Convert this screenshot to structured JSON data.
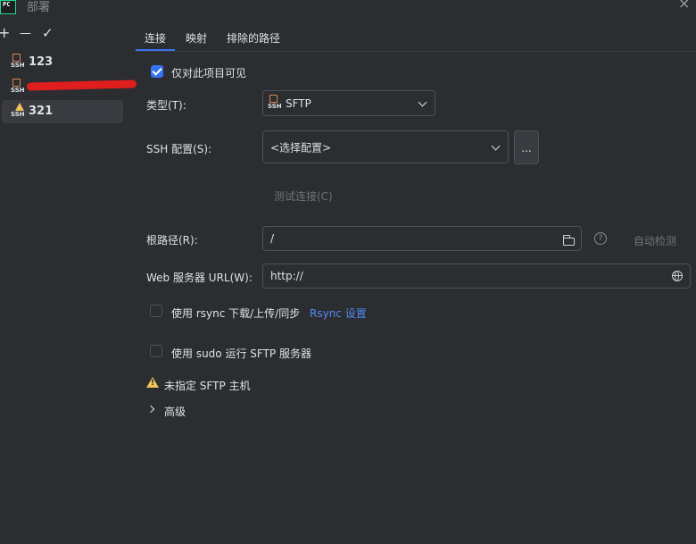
{
  "window": {
    "title": "部署",
    "app_icon_label": "PC"
  },
  "toolbar": {
    "add": "+",
    "remove": "—",
    "apply": "✓"
  },
  "servers": [
    {
      "name": "123",
      "icon": "ssh-icon"
    },
    {
      "name": " ",
      "icon": "ssh-icon",
      "redacted": true
    },
    {
      "name": "321",
      "icon": "ssh-warning-icon",
      "selected": true
    }
  ],
  "tabs": [
    {
      "label": "连接",
      "active": true
    },
    {
      "label": "映射"
    },
    {
      "label": "排除的路径"
    }
  ],
  "form": {
    "visible_only_project": {
      "label": "仅对此项目可见",
      "checked": true
    },
    "type": {
      "label": "类型(T):",
      "value": "SFTP"
    },
    "ssh_config": {
      "label": "SSH 配置(S):",
      "value": "<选择配置>",
      "more_button": "..."
    },
    "test_connection": "测试连接(C)",
    "root_path": {
      "label": "根路径(R):",
      "value": "/",
      "auto_detect": "自动检测"
    },
    "web_url": {
      "label": "Web 服务器 URL(W):",
      "value": "http://"
    },
    "rsync": {
      "label": "使用 rsync 下载/上传/同步",
      "checked": false,
      "link": "Rsync 设置"
    },
    "sudo": {
      "label": "使用 sudo 运行 SFTP 服务器",
      "checked": false
    },
    "warning": "未指定 SFTP 主机",
    "advanced": "高级"
  },
  "colors": {
    "accent": "#3574f0",
    "background": "#2b2d30",
    "warning": "#f2c55c",
    "link": "#548af7"
  }
}
